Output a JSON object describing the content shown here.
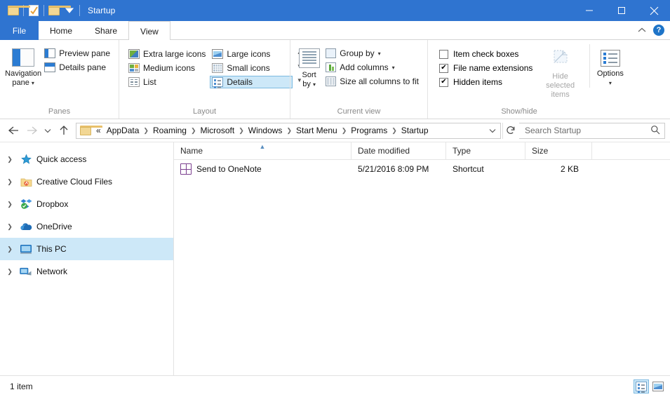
{
  "window": {
    "title": "Startup",
    "quick_access_toolbar": [
      {
        "name": "folder-properties",
        "icon": "folder-icon"
      },
      {
        "name": "properties",
        "icon": "properties-icon"
      },
      {
        "name": "new-folder",
        "icon": "folder-icon"
      },
      {
        "name": "customize-qat",
        "icon": "chevron-down-icon"
      }
    ],
    "controls": {
      "minimize": "minimize-icon",
      "maximize": "maximize-icon",
      "close": "close-icon"
    }
  },
  "tabs": {
    "file": "File",
    "items": [
      "Home",
      "Share",
      "View"
    ],
    "active": "View",
    "collapse_ribbon": "chevron-up-icon",
    "help": "?"
  },
  "ribbon": {
    "groups": [
      {
        "label": "Panes",
        "big_button": {
          "line1": "Navigation",
          "line2": "pane"
        },
        "small_buttons": [
          "Preview pane",
          "Details pane"
        ]
      },
      {
        "label": "Layout",
        "options": [
          {
            "label": "Extra large icons",
            "selected": false
          },
          {
            "label": "Large icons",
            "selected": false
          },
          {
            "label": "Medium icons",
            "selected": false
          },
          {
            "label": "Small icons",
            "selected": false
          },
          {
            "label": "List",
            "selected": false
          },
          {
            "label": "Details",
            "selected": true
          }
        ]
      },
      {
        "label": "Current view",
        "big_button": {
          "line1": "Sort",
          "line2": "by"
        },
        "small_buttons": [
          "Group by",
          "Add columns",
          "Size all columns to fit"
        ]
      },
      {
        "label": "Show/hide",
        "checkboxes": [
          {
            "label": "Item check boxes",
            "checked": false
          },
          {
            "label": "File name extensions",
            "checked": true
          },
          {
            "label": "Hidden items",
            "checked": true
          }
        ],
        "hide_selected": {
          "line1": "Hide selected",
          "line2": "items",
          "disabled": true
        },
        "options_button": "Options"
      }
    ]
  },
  "address_bar": {
    "back": "back-arrow-icon",
    "forward": "forward-arrow-icon",
    "recent": "chevron-down-icon",
    "up": "up-arrow-icon",
    "overflow": "«",
    "crumbs": [
      "AppData",
      "Roaming",
      "Microsoft",
      "Windows",
      "Start Menu",
      "Programs",
      "Startup"
    ],
    "dropdown": "chevron-down-icon",
    "refresh": "refresh-icon",
    "search_placeholder": "Search Startup",
    "search_value": "",
    "search_icon": "search-icon"
  },
  "navigation_pane": {
    "items": [
      {
        "label": "Quick access",
        "icon": "star-icon",
        "selected": false
      },
      {
        "label": "Creative Cloud Files",
        "icon": "creative-cloud-icon",
        "selected": false
      },
      {
        "label": "Dropbox",
        "icon": "dropbox-icon",
        "selected": false
      },
      {
        "label": "OneDrive",
        "icon": "cloud-icon",
        "selected": false
      },
      {
        "label": "This PC",
        "icon": "computer-icon",
        "selected": true
      },
      {
        "label": "Network",
        "icon": "network-icon",
        "selected": false
      }
    ]
  },
  "file_list": {
    "columns": [
      "Name",
      "Date modified",
      "Type",
      "Size"
    ],
    "sorted_by": "Name",
    "sort_direction": "ascending",
    "rows": [
      {
        "name": "Send to OneNote",
        "date_modified": "5/21/2016 8:09 PM",
        "type": "Shortcut",
        "size": "2 KB",
        "icon": "onenote-shortcut-icon"
      }
    ]
  },
  "status_bar": {
    "item_count": "1 item",
    "view_details": "details-view-icon",
    "view_large": "large-icons-view-icon"
  },
  "colors": {
    "titlebar": "#2f74d0",
    "accent": "#2f74d0",
    "selection": "#cde8f8",
    "selection_border": "#7cb9e0"
  }
}
